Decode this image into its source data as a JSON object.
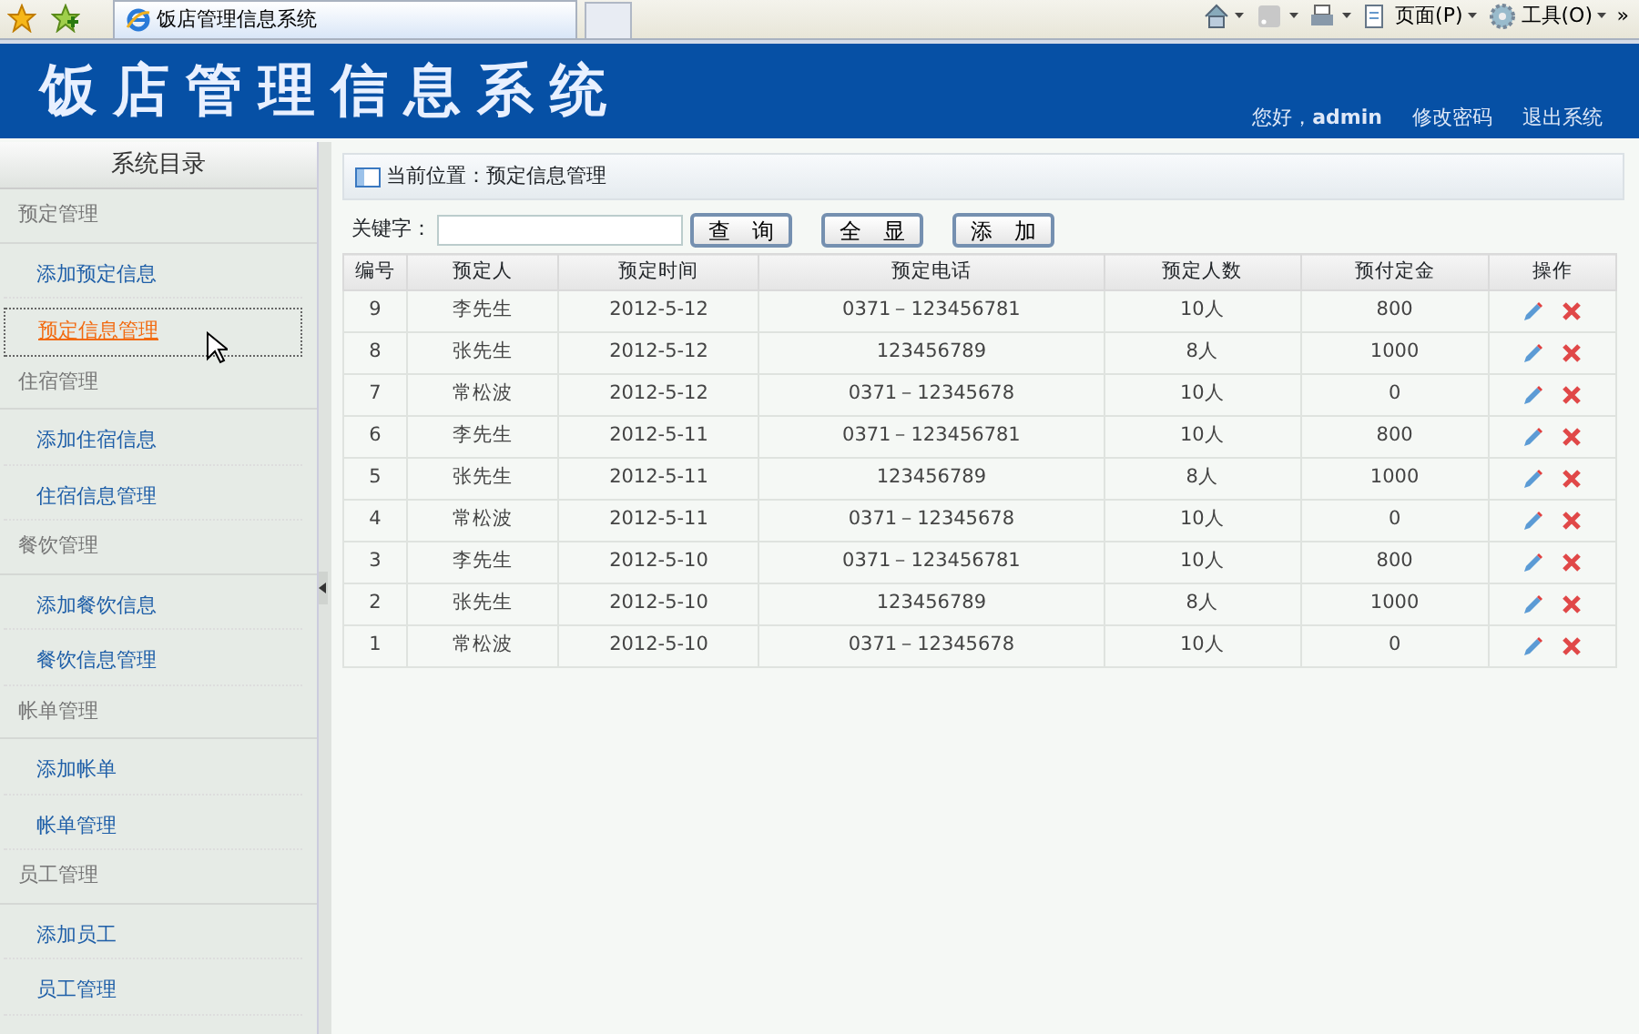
{
  "browser": {
    "tab_title": "饭店管理信息系统",
    "tools": [
      {
        "kind": "home"
      },
      {
        "kind": "feed"
      },
      {
        "kind": "print"
      },
      {
        "kind": "page",
        "label": "页面(P)"
      },
      {
        "kind": "tools",
        "label": "工具(O)"
      }
    ],
    "overflow": "»"
  },
  "header": {
    "title": "饭店管理信息系统",
    "greeting": "您好，",
    "user": "admin",
    "links": [
      "修改密码",
      "退出系统"
    ]
  },
  "sidebar": {
    "title": "系统目录",
    "groups": [
      {
        "label": "预定管理",
        "items": [
          {
            "label": "添加预定信息",
            "selected": false
          },
          {
            "label": "预定信息管理",
            "selected": true
          }
        ]
      },
      {
        "label": "住宿管理",
        "items": [
          {
            "label": "添加住宿信息",
            "selected": false
          },
          {
            "label": "住宿信息管理",
            "selected": false
          }
        ]
      },
      {
        "label": "餐饮管理",
        "items": [
          {
            "label": "添加餐饮信息",
            "selected": false
          },
          {
            "label": "餐饮信息管理",
            "selected": false
          }
        ]
      },
      {
        "label": "帐单管理",
        "items": [
          {
            "label": "添加帐单",
            "selected": false
          },
          {
            "label": "帐单管理",
            "selected": false
          }
        ]
      },
      {
        "label": "员工管理",
        "items": [
          {
            "label": "添加员工",
            "selected": false
          },
          {
            "label": "员工管理",
            "selected": false
          }
        ]
      }
    ]
  },
  "breadcrumb": "当前位置：预定信息管理",
  "search": {
    "label": "关键字：",
    "buttons": [
      "查　询",
      "全　显",
      "添　加"
    ]
  },
  "table": {
    "columns": [
      "编号",
      "预定人",
      "预定时间",
      "预定电话",
      "预定人数",
      "预付定金",
      "操作"
    ],
    "rows": [
      [
        "9",
        "李先生",
        "2012-5-12",
        "0371－123456781",
        "10人",
        "800"
      ],
      [
        "8",
        "张先生",
        "2012-5-12",
        "123456789",
        "8人",
        "1000"
      ],
      [
        "7",
        "常松波",
        "2012-5-12",
        "0371－12345678",
        "10人",
        "0"
      ],
      [
        "6",
        "李先生",
        "2012-5-11",
        "0371－123456781",
        "10人",
        "800"
      ],
      [
        "5",
        "张先生",
        "2012-5-11",
        "123456789",
        "8人",
        "1000"
      ],
      [
        "4",
        "常松波",
        "2012-5-11",
        "0371－12345678",
        "10人",
        "0"
      ],
      [
        "3",
        "李先生",
        "2012-5-10",
        "0371－123456781",
        "10人",
        "800"
      ],
      [
        "2",
        "张先生",
        "2012-5-10",
        "123456789",
        "8人",
        "1000"
      ],
      [
        "1",
        "常松波",
        "2012-5-10",
        "0371－12345678",
        "10人",
        "0"
      ]
    ]
  }
}
